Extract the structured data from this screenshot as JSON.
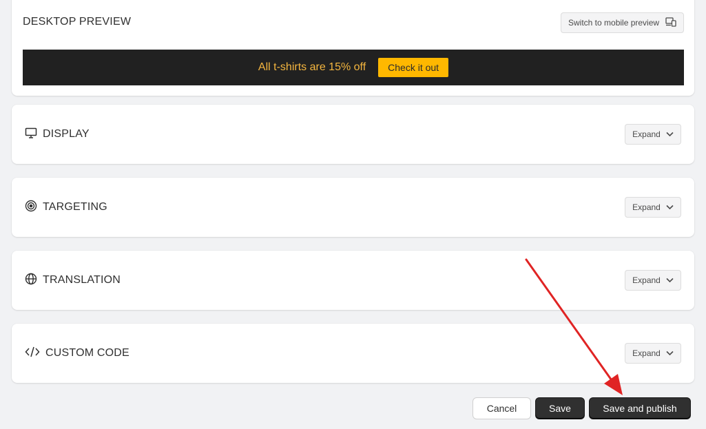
{
  "preview": {
    "title": "DESKTOP PREVIEW",
    "switch_label": "Switch to mobile preview",
    "switch_icon": "devices-icon",
    "bar_text": "All t-shirts are 15% off",
    "bar_button": "Check it out",
    "bar_bg": "#212121",
    "bar_text_color": "#f5b63f",
    "bar_button_color": "#ffb800"
  },
  "sections": [
    {
      "title": "DISPLAY",
      "icon": "monitor-icon",
      "expand_label": "Expand"
    },
    {
      "title": "TARGETING",
      "icon": "target-icon",
      "expand_label": "Expand"
    },
    {
      "title": "TRANSLATION",
      "icon": "globe-icon",
      "expand_label": "Expand"
    },
    {
      "title": "CUSTOM CODE",
      "icon": "code-icon",
      "expand_label": "Expand"
    }
  ],
  "footer": {
    "cancel_label": "Cancel",
    "save_label": "Save",
    "publish_label": "Save and publish"
  },
  "annotation": {
    "arrow_color": "#e02424"
  }
}
